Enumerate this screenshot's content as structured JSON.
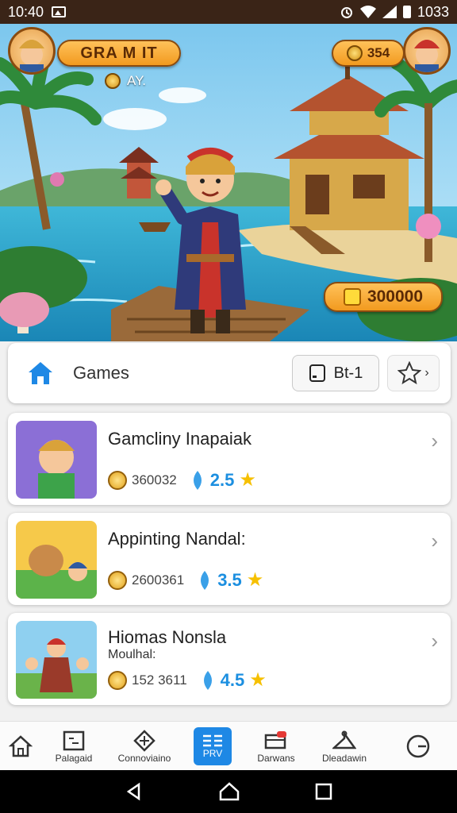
{
  "status_bar": {
    "time": "10:40",
    "battery": "1033"
  },
  "hero": {
    "player_name": "GRA M IT",
    "sub_label": "AY.",
    "coins": "354",
    "score": "300000"
  },
  "games_header": {
    "title": "Games",
    "bt_button": "Bt-1",
    "chevron": "›"
  },
  "games": [
    {
      "name": "Gamcliny Inapaiak",
      "subtitle": "",
      "coins": "360032",
      "rating": "2.5"
    },
    {
      "name": "Appinting Nandal:",
      "subtitle": "",
      "coins": "2600361",
      "rating": "3.5"
    },
    {
      "name": "Hiomas Nonsla",
      "subtitle": "Moulhal:",
      "coins": "152 3611",
      "rating": "4.5"
    }
  ],
  "bottom_nav": [
    {
      "label": "",
      "icon": "home-icon"
    },
    {
      "label": "Palagaid",
      "icon": "puzzle-icon"
    },
    {
      "label": "Connoviaino",
      "icon": "compass-icon"
    },
    {
      "label": "PRV",
      "icon": "list-icon",
      "active": true
    },
    {
      "label": "Darwans",
      "icon": "inbox-icon"
    },
    {
      "label": "Dleadawin",
      "icon": "hanger-icon"
    },
    {
      "label": "",
      "icon": "clock-icon"
    }
  ],
  "colors": {
    "accent": "#1e88e5",
    "status_bar": "#3a2417",
    "pill": "#f29a1f"
  }
}
